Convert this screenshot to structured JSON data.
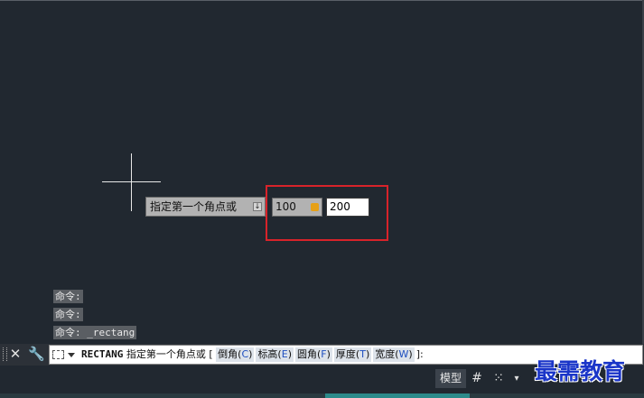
{
  "dynamic_input": {
    "prompt": "指定第一个角点或",
    "x_value": "100",
    "y_value": "200"
  },
  "command_history": [
    {
      "text": "命令:"
    },
    {
      "text": "命令:"
    },
    {
      "text": "命令: _rectang"
    }
  ],
  "command_line": {
    "command_name": "RECTANG",
    "prompt": "指定第一个角点或 [",
    "options": [
      {
        "label": "倒角(",
        "key": "C",
        "close": ")"
      },
      {
        "label": "标高(",
        "key": "E",
        "close": ")"
      },
      {
        "label": "圆角(",
        "key": "F",
        "close": ")"
      },
      {
        "label": "厚度(",
        "key": "T",
        "close": ")"
      },
      {
        "label": "宽度(",
        "key": "W",
        "close": ")"
      }
    ],
    "suffix": "]:"
  },
  "status_bar": {
    "model_label": "模型"
  },
  "watermark": "最需教育",
  "colors": {
    "canvas_bg": "#212830",
    "highlight_frame": "#d8232a",
    "option_key": "#1e4fbf",
    "watermark": "#1a35c8"
  },
  "icons": {
    "close": "close-icon",
    "wrench": "wrench-icon",
    "grid": "grid-icon",
    "snap": "snap-icon"
  }
}
